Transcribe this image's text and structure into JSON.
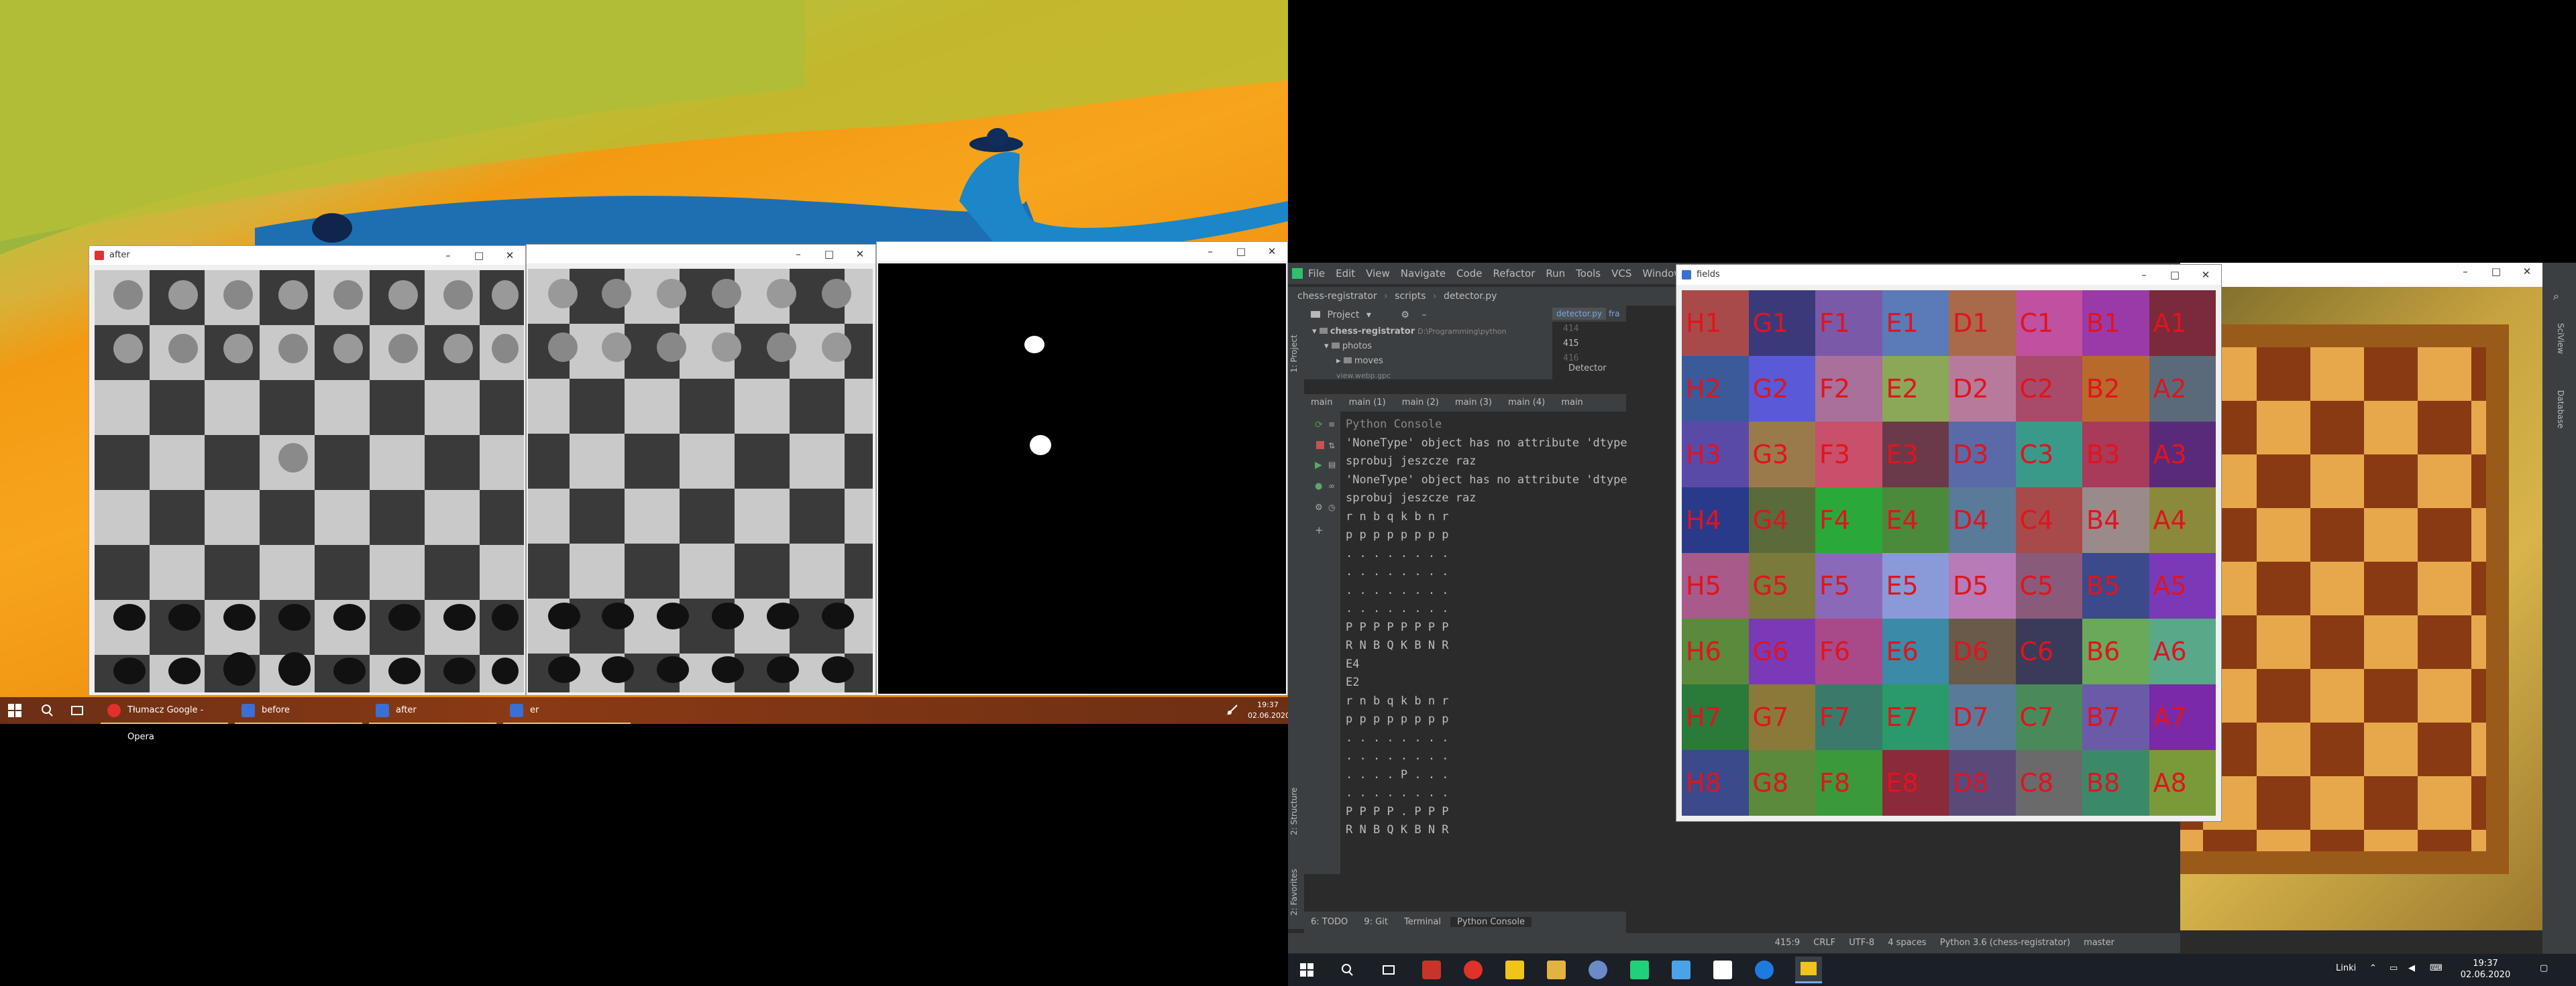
{
  "left_monitor": {
    "windows": [
      {
        "id": "after",
        "title": "after"
      },
      {
        "id": "before",
        "title": ""
      },
      {
        "id": "er",
        "title": ""
      }
    ],
    "taskbar": {
      "items": [
        {
          "label": "Tłumacz Google - Opera",
          "color": "#e0312b"
        },
        {
          "label": "before",
          "color": "#3b6fd1"
        },
        {
          "label": "after",
          "color": "#3b6fd1"
        },
        {
          "label": "er",
          "color": "#3b6fd1"
        }
      ],
      "clock_time": "19:37",
      "clock_date": "02.06.2020"
    }
  },
  "ide": {
    "menu": [
      "File",
      "Edit",
      "View",
      "Navigate",
      "Code",
      "Refactor",
      "Run",
      "Tools",
      "VCS",
      "Window"
    ],
    "breadcrumb": [
      "chess-registrator",
      "scripts",
      "detector.py"
    ],
    "project_label": "Project",
    "project_tree": [
      {
        "label": "chess-registrator",
        "path": "D:\\Programming\\python"
      },
      {
        "label": "photos"
      },
      {
        "label": "moves"
      },
      {
        "label": "view.webp.gpc"
      }
    ],
    "editor_tabs": [
      "detector.py",
      "fra"
    ],
    "gutter_lines": [
      "414",
      "415",
      "416"
    ],
    "editor_crumb": "Detector",
    "run_tabs": [
      "main",
      "main (1)",
      "main (2)",
      "main (3)",
      "main (4)",
      "main"
    ],
    "console_title": "Python Console",
    "console_lines": [
      "'NoneType' object has no attribute 'dtype'",
      "sprobuj jeszcze raz",
      "'NoneType' object has no attribute 'dtype'",
      "sprobuj jeszcze raz",
      "r n b q k b n r",
      "p p p p p p p p",
      ". . . . . . . .",
      ". . . . . . . .",
      ". . . . . . . .",
      ". . . . . . . .",
      "P P P P P P P P",
      "R N B Q K B N R",
      "E4",
      "E2",
      "r n b q k b n r",
      "p p p p p p p p",
      ". . . . . . . .",
      ". . . . . . . .",
      ". . . . P . . .",
      ". . . . . . . .",
      "P P P P . P P P",
      "R N B Q K B N R"
    ],
    "bottom_tabs": [
      "6: TODO",
      "9: Git",
      "Terminal",
      "Python Console"
    ],
    "left_strip": [
      "1: Project",
      "2: Structure",
      "2: Favorites"
    ],
    "right_strip": [
      "SciView",
      "Database"
    ],
    "status": {
      "position": "415:9",
      "line_sep": "CRLF",
      "encoding": "UTF-8",
      "indent": "4 spaces",
      "interpreter": "Python 3.6 (chess-registrator)",
      "branch": "master"
    }
  },
  "fields_window": {
    "title": "fields",
    "rows": [
      [
        "H1",
        "G1",
        "F1",
        "E1",
        "D1",
        "C1",
        "B1",
        "A1"
      ],
      [
        "H2",
        "G2",
        "F2",
        "E2",
        "D2",
        "C2",
        "B2",
        "A2"
      ],
      [
        "H3",
        "G3",
        "F3",
        "E3",
        "D3",
        "C3",
        "B3",
        "A3"
      ],
      [
        "H4",
        "G4",
        "F4",
        "E4",
        "D4",
        "C4",
        "B4",
        "A4"
      ],
      [
        "H5",
        "G5",
        "F5",
        "E5",
        "D5",
        "C5",
        "B5",
        "A5"
      ],
      [
        "H6",
        "G6",
        "F6",
        "E6",
        "D6",
        "C6",
        "B6",
        "A6"
      ],
      [
        "H7",
        "G7",
        "F7",
        "E7",
        "D7",
        "C7",
        "B7",
        "A7"
      ],
      [
        "H8",
        "G8",
        "F8",
        "E8",
        "D8",
        "C8",
        "B8",
        "A8"
      ]
    ],
    "cell_colors": [
      [
        "#a84a4a",
        "#3a3a7a",
        "#7a5aa8",
        "#5a7ab8",
        "#a86a4a",
        "#c050a0",
        "#9a3aa8",
        "#7a2a3a"
      ],
      [
        "#3a5a9a",
        "#5a5ad8",
        "#a8709a",
        "#8aa858",
        "#b87a9a",
        "#a84a6a",
        "#b86a2a",
        "#5a6a7a"
      ],
      [
        "#5a4aa8",
        "#9a7a4a",
        "#c8506a",
        "#6a3a4a",
        "#5a6aa8",
        "#3a9a8a",
        "#a83a5a",
        "#5a2a7a"
      ],
      [
        "#2a3a8a",
        "#5a6a3a",
        "#2aa83a",
        "#4a8a3a",
        "#5a7a9a",
        "#a84a4a",
        "#9a8a8a",
        "#8a8a3a"
      ],
      [
        "#a85a8a",
        "#7a7a3a",
        "#8a6ab8",
        "#8a9ad8",
        "#b87ab8",
        "#8a5a7a",
        "#3a4a8a",
        "#7a3ab8"
      ],
      [
        "#5a8a3a",
        "#7a3ab8",
        "#a84a8a",
        "#3a8aa8",
        "#6a5a4a",
        "#3a3a5a",
        "#6aa85a",
        "#5aa88a"
      ],
      [
        "#2a7a3a",
        "#8a7a3a",
        "#3a7a6a",
        "#2a9a6a",
        "#5a7a9a",
        "#4a8a5a",
        "#6a5aa8",
        "#7a2aa8"
      ],
      [
        "#3a4a8a",
        "#5a8a3a",
        "#3a9a3a",
        "#8a2a3a",
        "#5a4a7a",
        "#6a6a6a",
        "#3a8a6a",
        "#7a9a3a"
      ]
    ]
  },
  "right_taskbar": {
    "time": "19:37",
    "date": "02.06.2020",
    "lang": "Linki"
  }
}
